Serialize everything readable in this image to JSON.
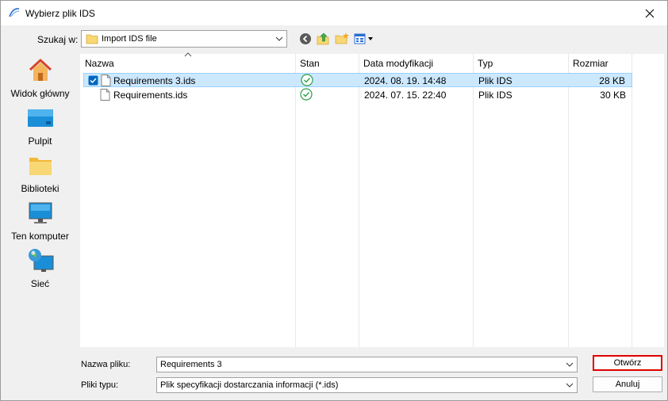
{
  "window": {
    "title": "Wybierz plik IDS"
  },
  "lookin": {
    "label": "Szukaj w:",
    "value": "Import IDS file"
  },
  "toolbar": {
    "icons": [
      "back-icon",
      "up-folder-icon",
      "new-folder-icon",
      "view-menu-icon"
    ]
  },
  "places": [
    {
      "label": "Widok główny",
      "icon": "home-icon"
    },
    {
      "label": "Pulpit",
      "icon": "desktop-icon"
    },
    {
      "label": "Biblioteki",
      "icon": "libraries-icon"
    },
    {
      "label": "Ten komputer",
      "icon": "computer-icon"
    },
    {
      "label": "Sieć",
      "icon": "network-icon"
    }
  ],
  "columns": [
    "Nazwa",
    "Stan",
    "Data modyfikacji",
    "Typ",
    "Rozmiar"
  ],
  "files": [
    {
      "name": "Requirements 3.ids",
      "status": "synced",
      "modified": "2024. 08. 19. 14:48",
      "type": "Plik IDS",
      "size": "28 KB",
      "selected": true
    },
    {
      "name": "Requirements.ids",
      "status": "synced",
      "modified": "2024. 07. 15. 22:40",
      "type": "Plik IDS",
      "size": "30 KB",
      "selected": false
    }
  ],
  "filename": {
    "label": "Nazwa pliku:",
    "value": "Requirements 3"
  },
  "filetype": {
    "label": "Pliki typu:",
    "value": "Plik specyfikacji dostarczania informacji (*.ids)"
  },
  "buttons": {
    "open": "Otwórz",
    "cancel": "Anuluj"
  },
  "colors": {
    "accent": "#0078d4",
    "selection": "#cce8ff",
    "highlight": "#e00000",
    "status_ok": "#2e9f4a"
  }
}
